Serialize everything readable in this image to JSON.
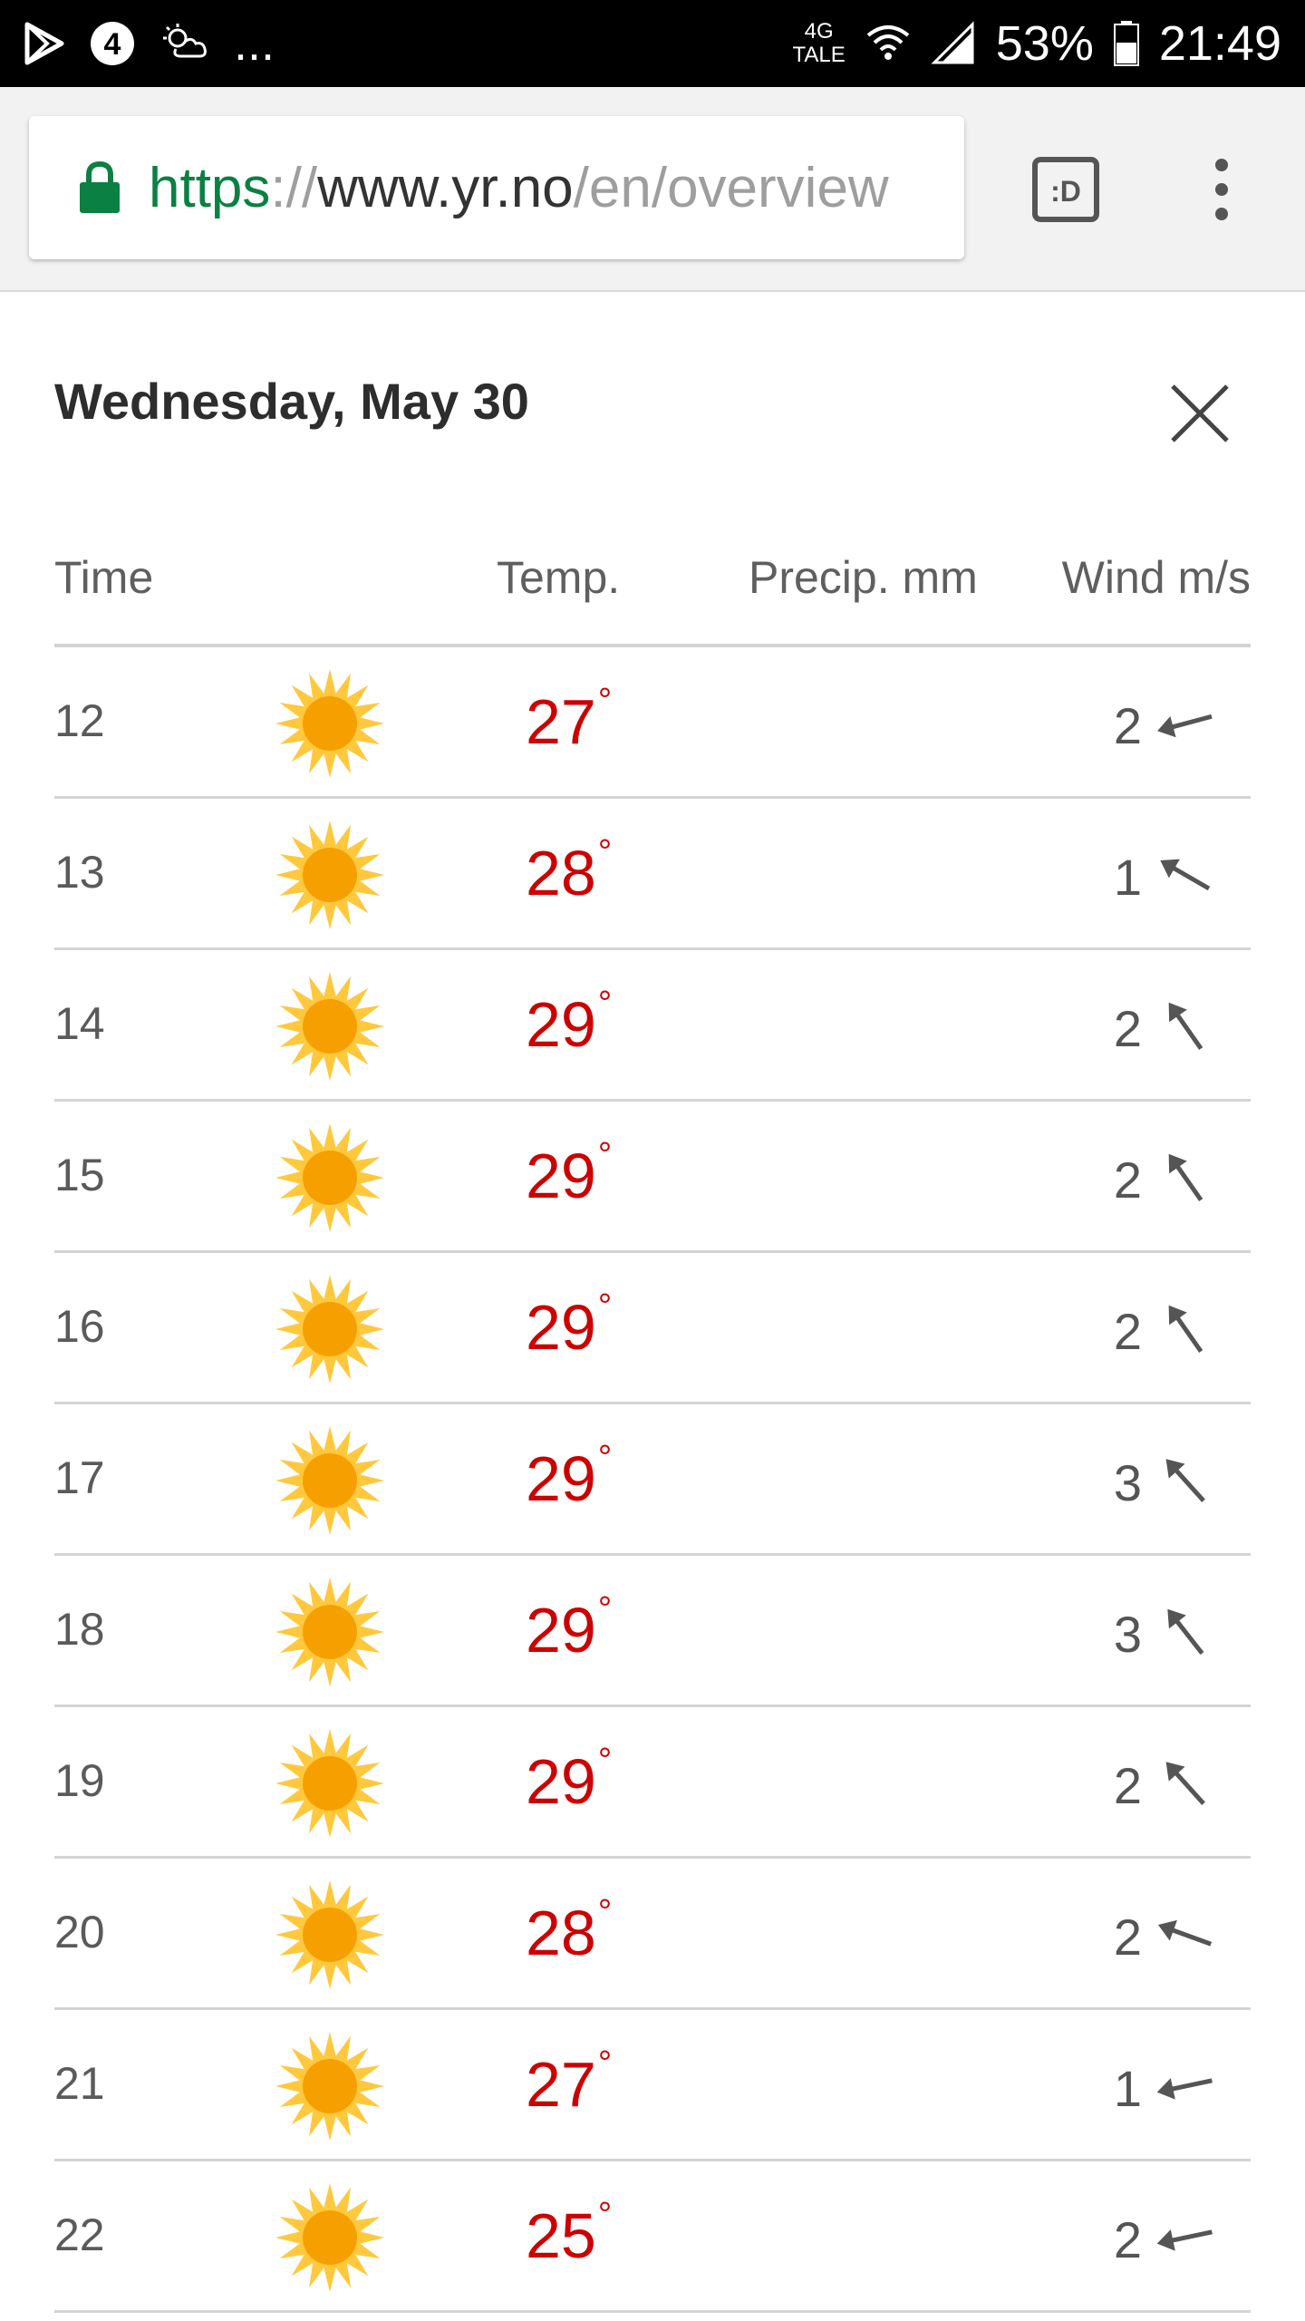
{
  "status_bar": {
    "notification_icons": [
      "play-store-icon",
      "channel4-icon",
      "weather-icon"
    ],
    "more_indicator": "...",
    "network_type_top": "4G",
    "network_type_bottom": "TALE",
    "battery_percent": "53%",
    "time": "21:49"
  },
  "browser": {
    "url_scheme": "https",
    "url_separator": "://",
    "url_host": "www.yr.no",
    "url_path": "/en/overview",
    "reader_label": ":D"
  },
  "panel": {
    "title": "Wednesday, May 30",
    "headers": {
      "time": "Time",
      "temp": "Temp.",
      "precip": "Precip. mm",
      "wind": "Wind m/s"
    },
    "degree_symbol": "°",
    "rows": [
      {
        "time": "12",
        "temp": "27",
        "precip": "",
        "wind": "2",
        "wind_direction_deg": 255,
        "icon": "sun-icon"
      },
      {
        "time": "13",
        "temp": "28",
        "precip": "",
        "wind": "1",
        "wind_direction_deg": 300,
        "icon": "sun-icon"
      },
      {
        "time": "14",
        "temp": "29",
        "precip": "",
        "wind": "2",
        "wind_direction_deg": 325,
        "icon": "sun-icon"
      },
      {
        "time": "15",
        "temp": "29",
        "precip": "",
        "wind": "2",
        "wind_direction_deg": 325,
        "icon": "sun-icon"
      },
      {
        "time": "16",
        "temp": "29",
        "precip": "",
        "wind": "2",
        "wind_direction_deg": 325,
        "icon": "sun-icon"
      },
      {
        "time": "17",
        "temp": "29",
        "precip": "",
        "wind": "3",
        "wind_direction_deg": 318,
        "icon": "sun-icon"
      },
      {
        "time": "18",
        "temp": "29",
        "precip": "",
        "wind": "3",
        "wind_direction_deg": 322,
        "icon": "sun-icon"
      },
      {
        "time": "19",
        "temp": "29",
        "precip": "",
        "wind": "2",
        "wind_direction_deg": 318,
        "icon": "sun-icon"
      },
      {
        "time": "20",
        "temp": "28",
        "precip": "",
        "wind": "2",
        "wind_direction_deg": 290,
        "icon": "sun-icon"
      },
      {
        "time": "21",
        "temp": "27",
        "precip": "",
        "wind": "1",
        "wind_direction_deg": 258,
        "icon": "sun-icon"
      },
      {
        "time": "22",
        "temp": "25",
        "precip": "",
        "wind": "2",
        "wind_direction_deg": 258,
        "icon": "sun-icon"
      }
    ]
  },
  "colors": {
    "temp_warm": "#cc0000",
    "url_secure": "#0b8043",
    "sun_outer": "#ffc83d",
    "sun_inner": "#f5a000"
  }
}
